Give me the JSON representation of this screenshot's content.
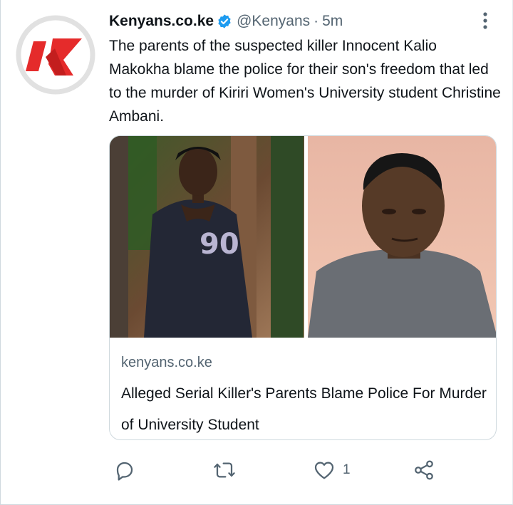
{
  "tweet": {
    "author": "Kenyans.co.ke",
    "handle": "@Kenyans",
    "separator": "·",
    "time": "5m",
    "text": "The parents of the suspected killer Innocent Kalio Makokha blame the police for their son's freedom that led to the murder of Kiriri Women's University student Christine Ambani.",
    "verified": true
  },
  "card": {
    "domain": "kenyans.co.ke",
    "title": "Alleged Serial Killer's Parents Blame Police For Murder of University Student"
  },
  "actions": {
    "reply_icon": "reply-icon",
    "retweet_icon": "retweet-icon",
    "like_icon": "like-icon",
    "like_count": "1",
    "share_icon": "share-icon"
  },
  "colors": {
    "accent": "#1d9bf0",
    "text": "#0f1419",
    "secondary": "#536471",
    "logo_red": "#e52b2b"
  }
}
